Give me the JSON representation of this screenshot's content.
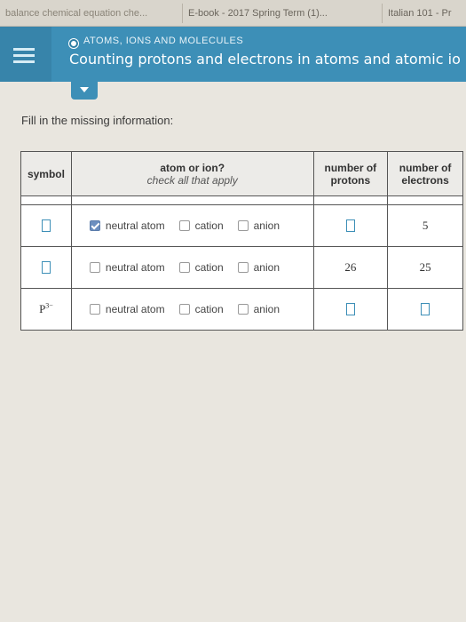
{
  "browser": {
    "tabs": [
      {
        "label": "balance chemical equation che..."
      },
      {
        "label": "E-book - 2017 Spring Term (1)..."
      },
      {
        "label": "Italian 101 - Pr"
      }
    ]
  },
  "header": {
    "topic": "ATOMS, IONS AND MOLECULES",
    "title": "Counting protons and electrons in atoms and atomic io"
  },
  "instructions": "Fill in the missing information:",
  "table": {
    "headers": {
      "symbol": "symbol",
      "atom_or_ion": "atom or ion?",
      "atom_or_ion_hint": "check all that apply",
      "protons": "number of protons",
      "electrons": "number of electrons"
    },
    "options": {
      "neutral": "neutral atom",
      "cation": "cation",
      "anion": "anion"
    },
    "rows": [
      {
        "symbol": "",
        "symbol_sup": "",
        "neutral": true,
        "cation": false,
        "anion": false,
        "protons": "",
        "electrons": "5"
      },
      {
        "symbol": "",
        "symbol_sup": "",
        "neutral": false,
        "cation": false,
        "anion": false,
        "protons": "26",
        "electrons": "25"
      },
      {
        "symbol": "P",
        "symbol_sup": "3−",
        "neutral": false,
        "cation": false,
        "anion": false,
        "protons": "",
        "electrons": ""
      }
    ]
  },
  "colors": {
    "accent": "#3d8fb7",
    "checked": "#6c8fbf"
  }
}
